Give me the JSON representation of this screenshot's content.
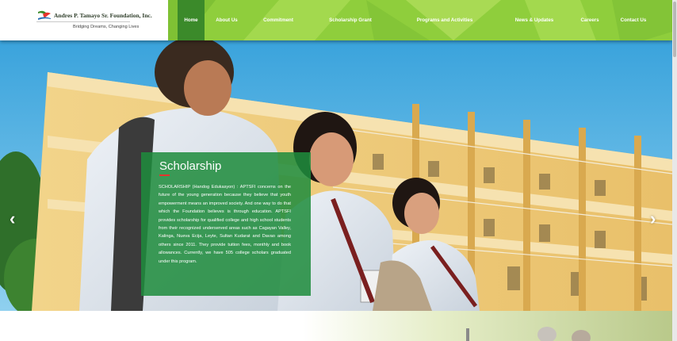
{
  "logo": {
    "name": "Andres P. Tamayo Sr. Foundation, Inc.",
    "tagline": "Bridging Dreams, Changing Lives"
  },
  "nav": {
    "items": [
      {
        "label": "Home",
        "active": true
      },
      {
        "label": "About Us",
        "active": false
      },
      {
        "label": "Commitment",
        "active": false
      },
      {
        "label": "Scholarship Grant",
        "active": false
      },
      {
        "label": "Programs and Activities",
        "active": false
      },
      {
        "label": "News & Updates",
        "active": false
      },
      {
        "label": "Careers",
        "active": false
      },
      {
        "label": "Contact Us",
        "active": false
      }
    ]
  },
  "slider": {
    "prev_icon": "‹",
    "next_icon": "›",
    "title": "Scholarship",
    "body": "SCHOLARSHIP (Handog Edukasyon) : APTSFI concerns on the future of the young generation because they believe that youth empowerment means an improved society. And one way to do that which the Foundation believes is through education. APTSFI provides scholarship for qualified college and high school students from their recognized underserved areas such as Cagayan Valley, Kalinga, Nueva Ecija, Leyte, Sultan Kudarat and Davao among others since 2011. They provide tuition fees, monthly and book allowances. Currently, we have 505 college scholars graduated under this program."
  },
  "colors": {
    "nav_green": "#8fce3c",
    "nav_active": "#3b8a2a",
    "box_green": "#1e8c3c",
    "accent_red": "#e8332d"
  },
  "icons": [
    "logo-mark-icon",
    "chevron-left-icon",
    "chevron-right-icon"
  ]
}
